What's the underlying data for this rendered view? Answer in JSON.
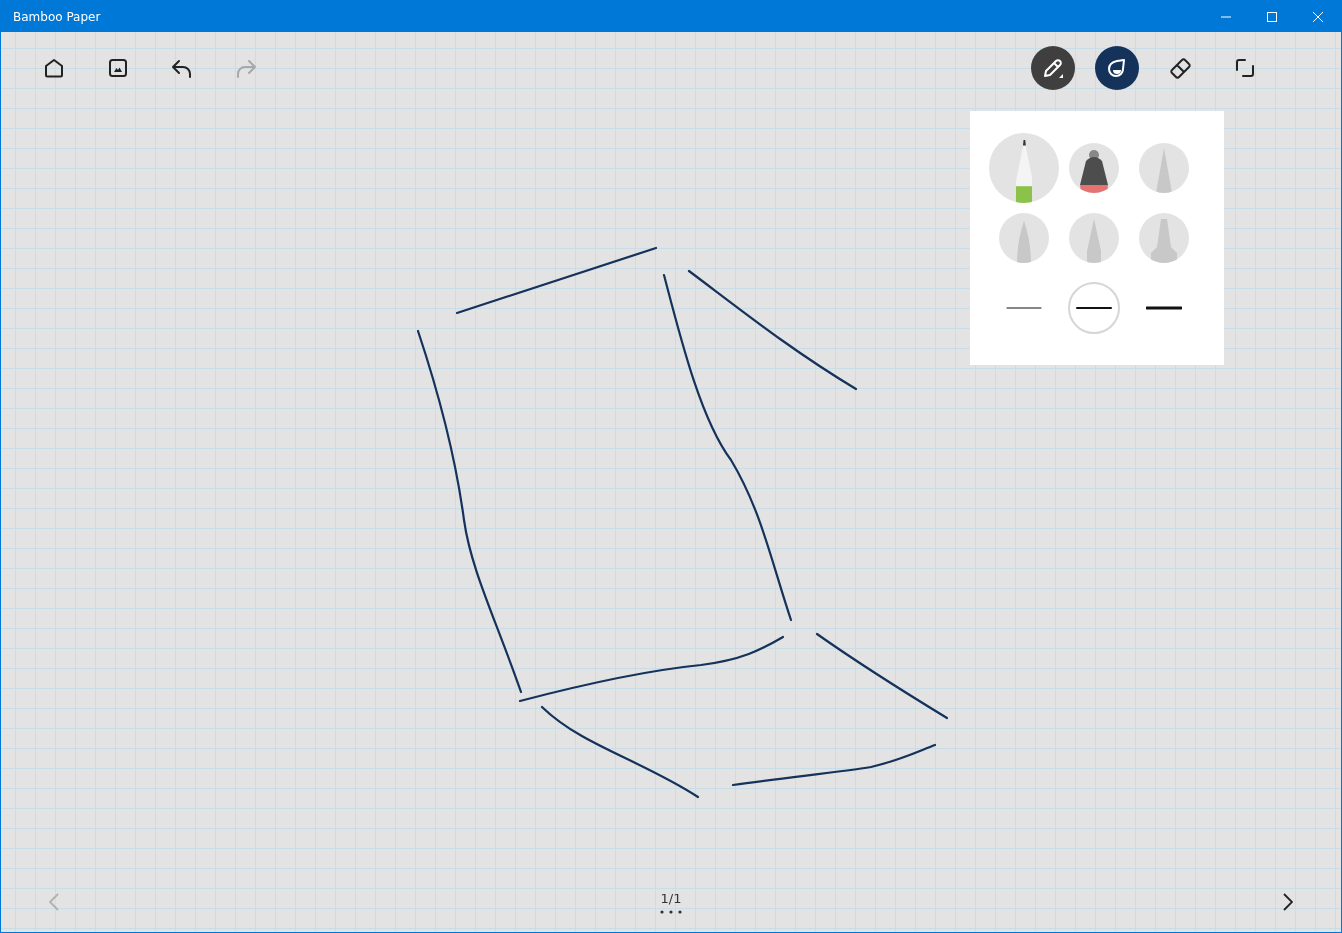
{
  "window": {
    "title": "Bamboo Paper"
  },
  "toolbar_left": [
    {
      "kind": "home",
      "disabled": false
    },
    {
      "kind": "image",
      "disabled": false
    },
    {
      "kind": "undo",
      "disabled": false
    },
    {
      "kind": "redo",
      "disabled": true
    }
  ],
  "toolbar_right": [
    {
      "kind": "pen",
      "selected": true
    },
    {
      "kind": "color"
    },
    {
      "kind": "eraser",
      "selected": false
    },
    {
      "kind": "lasso",
      "selected": false
    }
  ],
  "ink": {
    "color": "#14325a"
  },
  "pen_panel": {
    "pens": [
      {
        "kind": "pencil",
        "selected": true
      },
      {
        "kind": "eraser-tip",
        "selected": false
      },
      {
        "kind": "fine",
        "selected": false
      },
      {
        "kind": "brush",
        "selected": false
      },
      {
        "kind": "felt",
        "selected": false
      },
      {
        "kind": "marker",
        "selected": false
      }
    ],
    "widths": [
      {
        "kind": "thin",
        "selected": false
      },
      {
        "kind": "medium",
        "selected": true
      },
      {
        "kind": "thick",
        "selected": false
      }
    ]
  },
  "page_nav": {
    "page": "1/1",
    "prev_disabled": true,
    "next_disabled": false
  }
}
